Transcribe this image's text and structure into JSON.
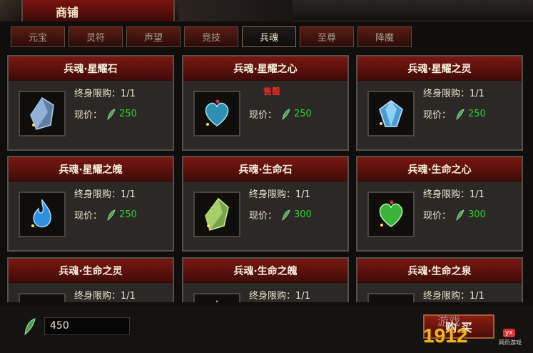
{
  "window": {
    "title": "商铺"
  },
  "tabs": [
    {
      "label": "元宝",
      "active": false
    },
    {
      "label": "灵符",
      "active": false
    },
    {
      "label": "声望",
      "active": false
    },
    {
      "label": "竞技",
      "active": false
    },
    {
      "label": "兵魂",
      "active": true
    },
    {
      "label": "至尊",
      "active": false
    },
    {
      "label": "降魔",
      "active": false
    }
  ],
  "items": [
    {
      "name": "兵魂·星耀石",
      "limit": "终身限购：1/1",
      "price_label": "现价：",
      "price": "250",
      "sold": "",
      "icon": "blue-crystal-icon"
    },
    {
      "name": "兵魂·星耀之心",
      "limit": "终身限购：1/1",
      "price_label": "现价：",
      "price": "250",
      "sold": "售罄",
      "icon": "blue-heart-icon"
    },
    {
      "name": "兵魂·星耀之灵",
      "limit": "终身限购：1/1",
      "price_label": "现价：",
      "price": "250",
      "sold": "",
      "icon": "blue-gem-icon"
    },
    {
      "name": "兵魂·星耀之魄",
      "limit": "终身限购：1/1",
      "price_label": "现价：",
      "price": "250",
      "sold": "",
      "icon": "blue-flame-icon"
    },
    {
      "name": "兵魂·生命石",
      "limit": "终身限购：1/1",
      "price_label": "现价：",
      "price": "300",
      "sold": "",
      "icon": "green-crystal-icon"
    },
    {
      "name": "兵魂·生命之心",
      "limit": "终身限购：1/1",
      "price_label": "现价：",
      "price": "300",
      "sold": "",
      "icon": "green-heart-icon"
    },
    {
      "name": "兵魂·生命之灵",
      "limit": "终身限购：1/1",
      "price_label": "",
      "price": "",
      "sold": "",
      "icon": "green-gem-icon"
    },
    {
      "name": "兵魂·生命之魄",
      "limit": "终身限购：1/1",
      "price_label": "",
      "price": "",
      "sold": "",
      "icon": "green-flame-icon"
    },
    {
      "name": "兵魂·生命之泉",
      "limit": "终身限购：1/1",
      "price_label": "",
      "price": "",
      "sold": "",
      "icon": "green-spring-icon"
    }
  ],
  "footer": {
    "balance": "450",
    "buy_label": "购 买"
  },
  "watermark": {
    "brand": "1912",
    "tag": "yx",
    "sub": "网页游戏",
    "top": "游戏"
  },
  "colors": {
    "price_green": "#2dd333",
    "sold_red": "#e42c28",
    "header_red": "#7a1712"
  }
}
